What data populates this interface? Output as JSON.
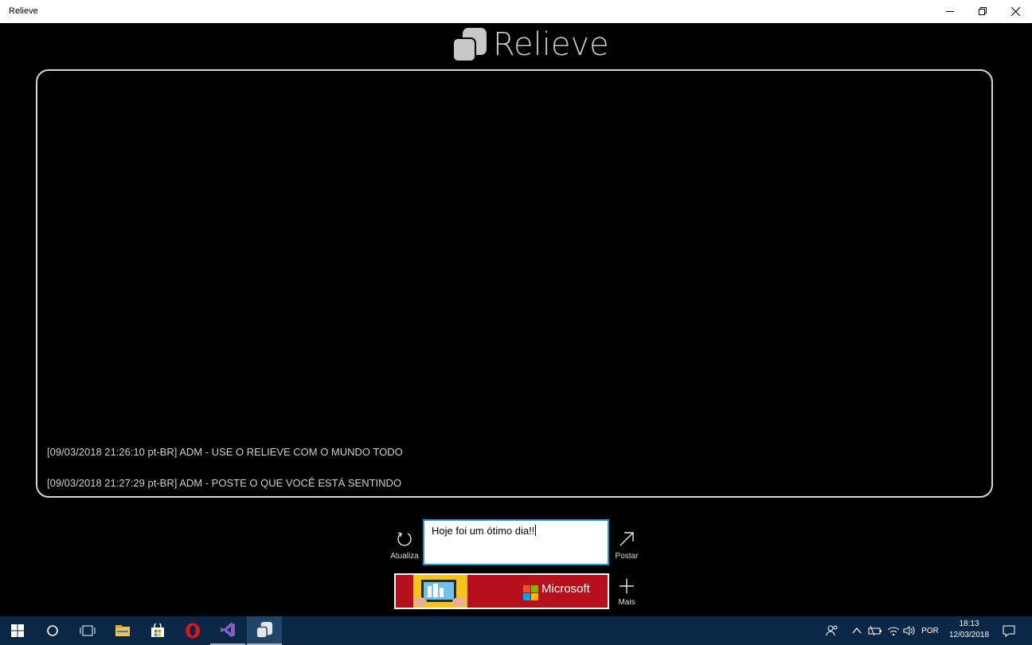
{
  "window": {
    "title": "Relieve"
  },
  "app": {
    "logo_text": "Relieve"
  },
  "feed": {
    "messages": [
      "[09/03/2018 21:26:10 pt-BR] ADM - USE O RELIEVE COM O MUNDO TODO",
      "[09/03/2018 21:27:29 pt-BR] ADM - POSTE O QUE VOCÊ ESTÁ SENTINDO"
    ]
  },
  "actions": {
    "refresh_label": "Atualiza",
    "post_label": "Postar",
    "more_label": "Mais",
    "input_value": "Hoje foi um ótimo dia!!"
  },
  "ad": {
    "brand": "Microsoft"
  },
  "taskbar": {
    "language": "POR",
    "time": "18:13",
    "date": "12/03/2018"
  },
  "colors": {
    "accent": "#1e90d8",
    "taskbar": "#0a2846",
    "ad_background": "#b5101b"
  }
}
